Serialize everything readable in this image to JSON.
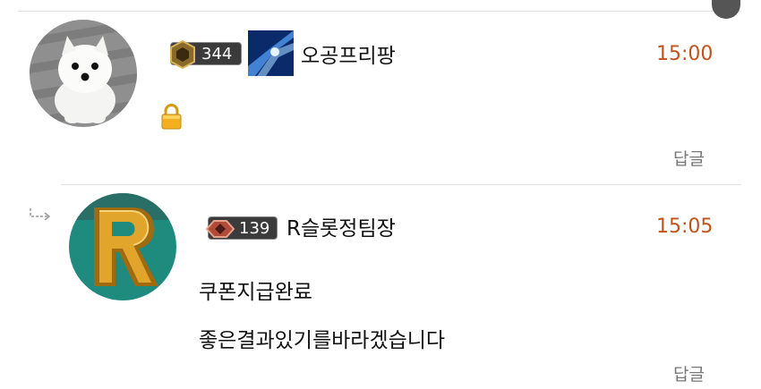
{
  "comments": [
    {
      "level": "344",
      "nickname": "오공프리팡",
      "time": "15:00",
      "reply_label": "답글"
    }
  ],
  "replies": [
    {
      "level": "139",
      "nickname": "R슬롯정팀장",
      "time": "15:05",
      "lines": [
        "쿠폰지급완료",
        "좋은결과있기를바라겠습니다"
      ],
      "reply_label": "답글"
    }
  ],
  "colors": {
    "time": "#c0531c",
    "badge_bg": "#3b3b3b",
    "lock": "#f2b01e"
  },
  "icons": [
    "lock-icon",
    "reply-arrow-icon",
    "level-emblem-icon"
  ]
}
